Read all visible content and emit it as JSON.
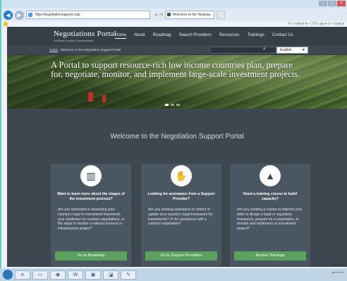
{
  "browser": {
    "url": "http://negotiationsupport.org/",
    "url_tools": "ρ - ↻",
    "tab_title": "Welcome to the Negotia...",
    "cmd_items": "ページ(P) ▾  セーフティ(S) ▾  ツール(O) ▾"
  },
  "site": {
    "logo_title": "Negotiations Portal",
    "logo_subtitle": "for Host Country Governments",
    "nav": [
      "Home",
      "About",
      "Roadmap",
      "Search Providers",
      "Resources",
      "Trainings",
      "Contact Us"
    ],
    "breadcrumb_home": "Home",
    "breadcrumb_sep": " › ",
    "breadcrumb_current": "Welcome to the Negotiation Support Portal",
    "search_placeholder": "",
    "language": "English",
    "hero_text": "A Portal to support resource-rich low income countries plan, prepare for, negotiate, monitor, and implement large-scale investment projects.",
    "welcome": "Welcome to the Negotiation Support Portal",
    "cards": [
      {
        "icon": "map-icon",
        "title": "Want to learn more about the stages of the investment process?",
        "body": "Are you interested in assessing your country's legal or investment framework, your readiness for contract negotiations, or the steps to monitor a natural resource or infrastructure project?",
        "button": "Go to Roadmap"
      },
      {
        "icon": "handshake-icon",
        "title": "Looking for assistance from a Support Provider?",
        "body": "Are you seeking assistance to reform or update your country's legal framework for investments? Or for assistance with a contract negotiation?",
        "button": "Go to Support Providers"
      },
      {
        "icon": "graduation-cap-icon",
        "title": "Need a training course to build capacity?",
        "body": "Are you seeking a course to improve your skills to design a legal or regulatory framework, prepare for a negotiation, or monitor and implement an investment project?",
        "button": "Access Trainings"
      }
    ]
  },
  "status": {
    "zoom": "100% ▾"
  },
  "colors": {
    "page_bg": "#3c4750",
    "card_bg": "#4a5661",
    "button": "#5aa15e",
    "accent": "#5fcfc3"
  }
}
